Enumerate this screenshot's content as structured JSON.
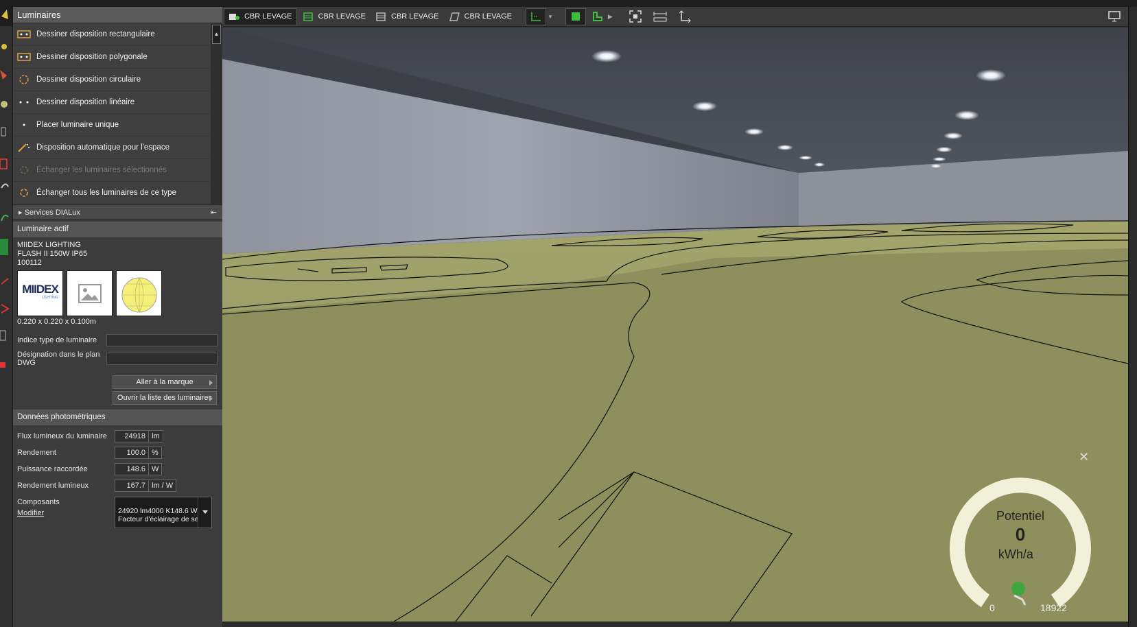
{
  "panel": {
    "title": "Luminaires",
    "menu": [
      {
        "label": "Dessiner disposition rectangulaire",
        "icon": "rect-layout-icon",
        "disabled": false
      },
      {
        "label": "Dessiner disposition polygonale",
        "icon": "poly-layout-icon",
        "disabled": false
      },
      {
        "label": "Dessiner disposition circulaire",
        "icon": "circle-layout-icon",
        "disabled": false
      },
      {
        "label": "Dessiner disposition linéaire",
        "icon": "line-layout-icon",
        "disabled": false
      },
      {
        "label": "Placer luminaire unique",
        "icon": "single-luminaire-icon",
        "disabled": false
      },
      {
        "label": "Disposition automatique pour l'espace",
        "icon": "magic-wand-icon",
        "disabled": false
      },
      {
        "label": "Échanger les luminaires sélectionnés",
        "icon": "swap-selected-icon",
        "disabled": true
      },
      {
        "label": "Échanger tous les luminaires de ce type",
        "icon": "swap-all-icon",
        "disabled": false
      }
    ],
    "services": "Services DIALux",
    "active_title": "Luminaire actif",
    "lum_line1": "MIIDEX LIGHTING",
    "lum_line2": "FLASH II 150W IP65",
    "lum_line3": "100112",
    "logo_text": "MIIDEX",
    "logo_sub": "LIGHTING",
    "dimensions": "0.220 x 0.220 x 0.100m",
    "type_index_label": "Indice type de luminaire",
    "dwg_label": "Désignation dans le plan DWG",
    "goto_brand": "Aller à la marque",
    "open_list": "Ouvrir la liste des luminaires",
    "photometric_title": "Données photométriques",
    "photometric": [
      {
        "label": "Flux lumineux du luminaire",
        "value": "24918",
        "unit": "lm"
      },
      {
        "label": "Rendement",
        "value": "100.0",
        "unit": "%"
      },
      {
        "label": "Puissance raccordée",
        "value": "148.6",
        "unit": "W"
      },
      {
        "label": "Rendement lumineux",
        "value": "167.7",
        "unit": "lm / W"
      }
    ],
    "components_label": "Composants",
    "modify_label": "Modifier",
    "components_line1": "24920 lm4000 K148.6 W",
    "components_line2": "Facteur d'éclairage de se"
  },
  "viewbar": {
    "tabs": [
      "CBR LEVAGE",
      "CBR LEVAGE",
      "CBR LEVAGE",
      "CBR LEVAGE"
    ]
  },
  "gauge": {
    "title": "Potentiel",
    "value": "0",
    "unit": "kWh/a",
    "min": "0",
    "max": "18922",
    "level": 0
  },
  "colors": {
    "accent_green": "#3fbf3f",
    "gauge_ring": "#f1f0d8",
    "floor": "#8c8e5a",
    "ceiling": "#4c5058"
  }
}
